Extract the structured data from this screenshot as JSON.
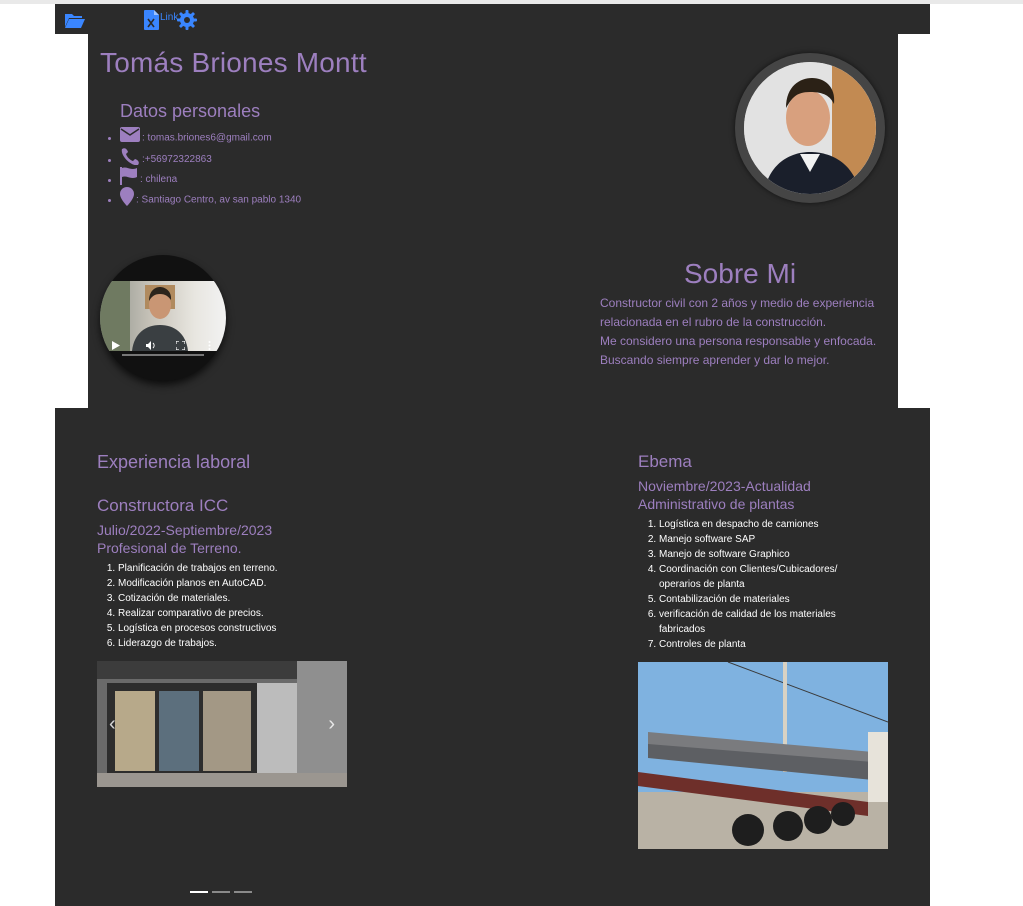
{
  "navbar": {
    "link_label": "Link",
    "icons": [
      "folder-open-icon",
      "excel-file-icon",
      "gear-icon"
    ],
    "accent": "#3a86ff"
  },
  "profile": {
    "name": "Tomás Briones Montt",
    "personal_title": "Datos personales",
    "email": ": tomas.briones6@gmail.com",
    "phone": ":+56972322863",
    "nationality": ": chilena",
    "address": ": Santiago Centro, av san pablo 1340",
    "text_color": "#9d7fbf"
  },
  "about": {
    "title": "Sobre Mi",
    "lines": [
      "Constructor civil con 2 años y medio de experiencia",
      "relacionada en el rubro de la construcción.",
      "Me considero una persona responsable y enfocada.",
      "Buscando siempre aprender y dar lo mejor."
    ]
  },
  "experience": {
    "title": "Experiencia laboral",
    "jobs": [
      {
        "company": "Constructora ICC",
        "dates": "Julio/2022-Septiembre/2023",
        "role": "Profesional de Terreno.",
        "tasks": [
          "Planificación de trabajos en terreno.",
          "Modificación planos en AutoCAD.",
          "Cotización de materiales.",
          "Realizar comparativo de precios.",
          "Logística en procesos constructivos",
          "Liderazgo de trabajos."
        ]
      },
      {
        "company": "Ebema",
        "dates": "Noviembre/2023-Actualidad",
        "role": "Administrativo de plantas",
        "tasks": [
          "Logística en despacho de camiones",
          "Manejo software SAP",
          "Manejo de software Graphico",
          "Coordinación con Clientes/Cubicadores/ operarios de planta",
          "Contabilización de materiales",
          "verificación de calidad de los materiales fabricados",
          "Controles de planta"
        ]
      }
    ]
  },
  "carousel": {
    "prev_icon": "chevron-left-icon",
    "next_icon": "chevron-right-icon",
    "slides": 3,
    "active_slide": 1
  }
}
